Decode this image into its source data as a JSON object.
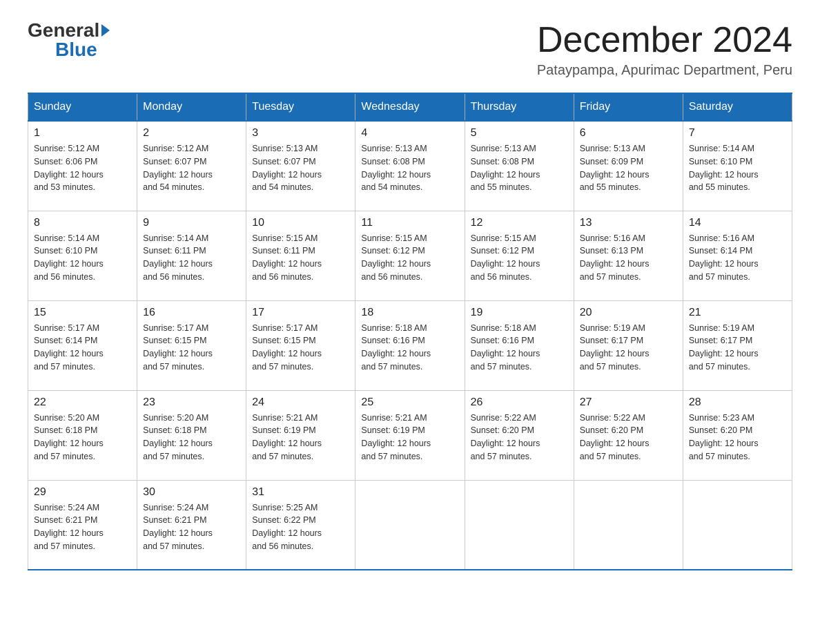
{
  "logo": {
    "general": "General",
    "blue": "Blue"
  },
  "header": {
    "month": "December 2024",
    "location": "Pataypampa, Apurimac Department, Peru"
  },
  "weekdays": [
    "Sunday",
    "Monday",
    "Tuesday",
    "Wednesday",
    "Thursday",
    "Friday",
    "Saturday"
  ],
  "weeks": [
    [
      {
        "day": "1",
        "sunrise": "5:12 AM",
        "sunset": "6:06 PM",
        "daylight": "12 hours and 53 minutes."
      },
      {
        "day": "2",
        "sunrise": "5:12 AM",
        "sunset": "6:07 PM",
        "daylight": "12 hours and 54 minutes."
      },
      {
        "day": "3",
        "sunrise": "5:13 AM",
        "sunset": "6:07 PM",
        "daylight": "12 hours and 54 minutes."
      },
      {
        "day": "4",
        "sunrise": "5:13 AM",
        "sunset": "6:08 PM",
        "daylight": "12 hours and 54 minutes."
      },
      {
        "day": "5",
        "sunrise": "5:13 AM",
        "sunset": "6:08 PM",
        "daylight": "12 hours and 55 minutes."
      },
      {
        "day": "6",
        "sunrise": "5:13 AM",
        "sunset": "6:09 PM",
        "daylight": "12 hours and 55 minutes."
      },
      {
        "day": "7",
        "sunrise": "5:14 AM",
        "sunset": "6:10 PM",
        "daylight": "12 hours and 55 minutes."
      }
    ],
    [
      {
        "day": "8",
        "sunrise": "5:14 AM",
        "sunset": "6:10 PM",
        "daylight": "12 hours and 56 minutes."
      },
      {
        "day": "9",
        "sunrise": "5:14 AM",
        "sunset": "6:11 PM",
        "daylight": "12 hours and 56 minutes."
      },
      {
        "day": "10",
        "sunrise": "5:15 AM",
        "sunset": "6:11 PM",
        "daylight": "12 hours and 56 minutes."
      },
      {
        "day": "11",
        "sunrise": "5:15 AM",
        "sunset": "6:12 PM",
        "daylight": "12 hours and 56 minutes."
      },
      {
        "day": "12",
        "sunrise": "5:15 AM",
        "sunset": "6:12 PM",
        "daylight": "12 hours and 56 minutes."
      },
      {
        "day": "13",
        "sunrise": "5:16 AM",
        "sunset": "6:13 PM",
        "daylight": "12 hours and 57 minutes."
      },
      {
        "day": "14",
        "sunrise": "5:16 AM",
        "sunset": "6:14 PM",
        "daylight": "12 hours and 57 minutes."
      }
    ],
    [
      {
        "day": "15",
        "sunrise": "5:17 AM",
        "sunset": "6:14 PM",
        "daylight": "12 hours and 57 minutes."
      },
      {
        "day": "16",
        "sunrise": "5:17 AM",
        "sunset": "6:15 PM",
        "daylight": "12 hours and 57 minutes."
      },
      {
        "day": "17",
        "sunrise": "5:17 AM",
        "sunset": "6:15 PM",
        "daylight": "12 hours and 57 minutes."
      },
      {
        "day": "18",
        "sunrise": "5:18 AM",
        "sunset": "6:16 PM",
        "daylight": "12 hours and 57 minutes."
      },
      {
        "day": "19",
        "sunrise": "5:18 AM",
        "sunset": "6:16 PM",
        "daylight": "12 hours and 57 minutes."
      },
      {
        "day": "20",
        "sunrise": "5:19 AM",
        "sunset": "6:17 PM",
        "daylight": "12 hours and 57 minutes."
      },
      {
        "day": "21",
        "sunrise": "5:19 AM",
        "sunset": "6:17 PM",
        "daylight": "12 hours and 57 minutes."
      }
    ],
    [
      {
        "day": "22",
        "sunrise": "5:20 AM",
        "sunset": "6:18 PM",
        "daylight": "12 hours and 57 minutes."
      },
      {
        "day": "23",
        "sunrise": "5:20 AM",
        "sunset": "6:18 PM",
        "daylight": "12 hours and 57 minutes."
      },
      {
        "day": "24",
        "sunrise": "5:21 AM",
        "sunset": "6:19 PM",
        "daylight": "12 hours and 57 minutes."
      },
      {
        "day": "25",
        "sunrise": "5:21 AM",
        "sunset": "6:19 PM",
        "daylight": "12 hours and 57 minutes."
      },
      {
        "day": "26",
        "sunrise": "5:22 AM",
        "sunset": "6:20 PM",
        "daylight": "12 hours and 57 minutes."
      },
      {
        "day": "27",
        "sunrise": "5:22 AM",
        "sunset": "6:20 PM",
        "daylight": "12 hours and 57 minutes."
      },
      {
        "day": "28",
        "sunrise": "5:23 AM",
        "sunset": "6:20 PM",
        "daylight": "12 hours and 57 minutes."
      }
    ],
    [
      {
        "day": "29",
        "sunrise": "5:24 AM",
        "sunset": "6:21 PM",
        "daylight": "12 hours and 57 minutes."
      },
      {
        "day": "30",
        "sunrise": "5:24 AM",
        "sunset": "6:21 PM",
        "daylight": "12 hours and 57 minutes."
      },
      {
        "day": "31",
        "sunrise": "5:25 AM",
        "sunset": "6:22 PM",
        "daylight": "12 hours and 56 minutes."
      },
      null,
      null,
      null,
      null
    ]
  ]
}
